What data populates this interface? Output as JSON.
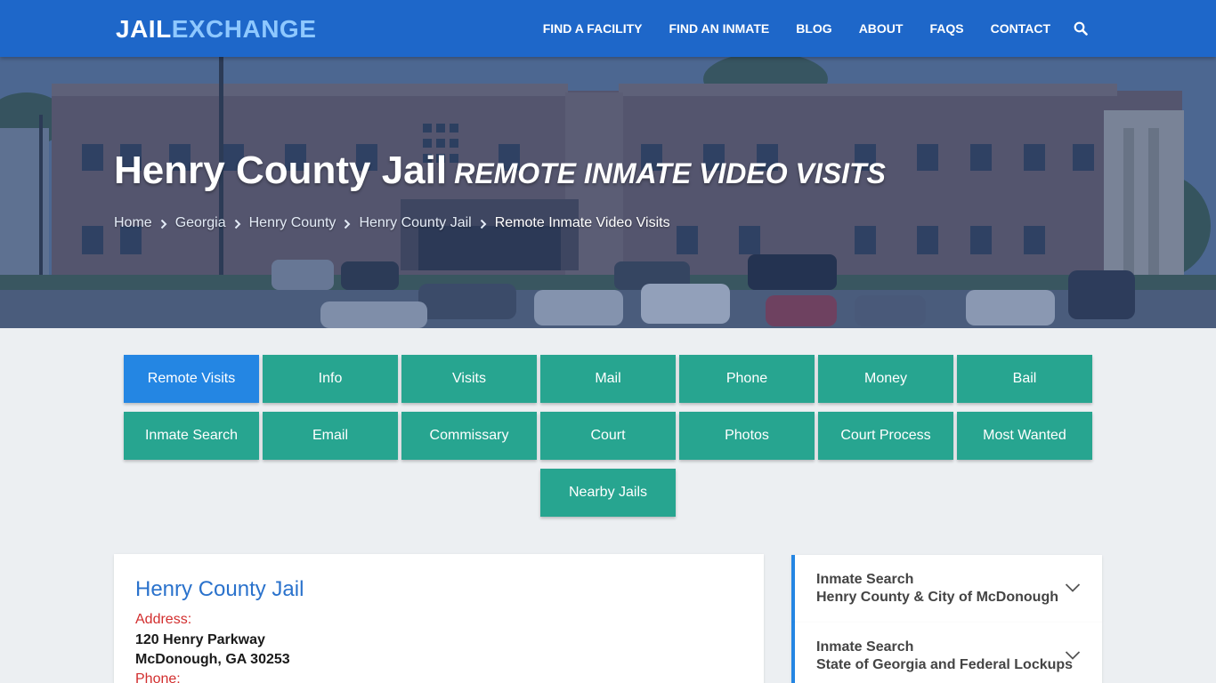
{
  "brand": {
    "logo_part1": "JAIL",
    "logo_part2": "EXCHANGE"
  },
  "nav": {
    "items": [
      "FIND A FACILITY",
      "FIND AN INMATE",
      "BLOG",
      "ABOUT",
      "FAQs",
      "CONTACT"
    ],
    "search_icon": "search-icon"
  },
  "hero": {
    "title": "Henry County Jail",
    "subtitle": "REMOTE INMATE VIDEO VISITS",
    "breadcrumb": [
      "Home",
      "Georgia",
      "Henry County",
      "Henry County Jail",
      "Remote Inmate Video Visits"
    ]
  },
  "buttons": {
    "row1": [
      "Remote Visits",
      "Info",
      "Visits",
      "Mail",
      "Phone",
      "Money",
      "Bail"
    ],
    "row2": [
      "Inmate Search",
      "Email",
      "Commissary",
      "Court",
      "Photos",
      "Court Process",
      "Most Wanted"
    ],
    "row3": [
      "Nearby Jails"
    ],
    "active": "Remote Visits"
  },
  "facility": {
    "name": "Henry County Jail",
    "address_label": "Address:",
    "address_line1": "120 Henry Parkway",
    "address_line2": "McDonough, GA 30253",
    "phone_label": "Phone:"
  },
  "sidebar": {
    "items": [
      {
        "line1": "Inmate Search",
        "line2": "Henry County & City of McDonough"
      },
      {
        "line1": "Inmate Search",
        "line2": "State of Georgia and Federal Lockups"
      }
    ]
  },
  "colors": {
    "navbar": "#1e67c9",
    "button_teal": "#27a590",
    "button_active": "#2486e3",
    "facility_title": "#2a72cc",
    "label_red": "#d22e2e"
  }
}
